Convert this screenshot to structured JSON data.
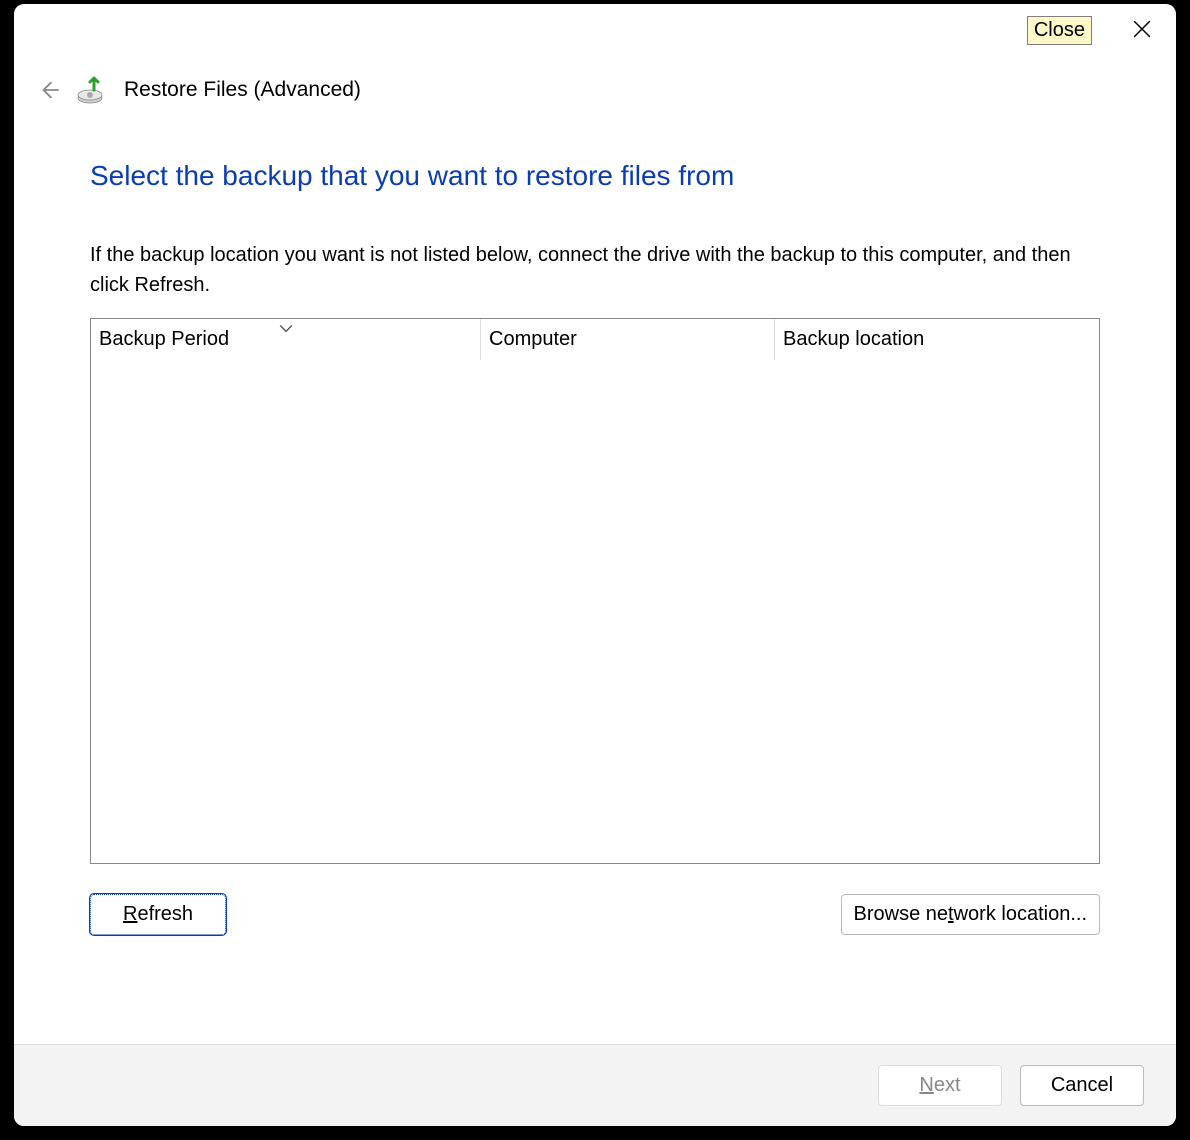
{
  "titlebar": {
    "close_tooltip": "Close"
  },
  "header": {
    "title": "Restore Files (Advanced)"
  },
  "main": {
    "heading": "Select the backup that you want to restore files from",
    "description": "If the backup location you want is not listed below, connect the drive with the backup to this computer, and then click Refresh.",
    "columns": {
      "col1": "Backup Period",
      "col2": "Computer",
      "col3": "Backup location"
    },
    "rows": []
  },
  "buttons": {
    "refresh_pre": "",
    "refresh_u": "R",
    "refresh_post": "efresh",
    "browse_pre": "Browse ne",
    "browse_u": "t",
    "browse_post": "work location..."
  },
  "footer": {
    "next_pre": "",
    "next_u": "N",
    "next_post": "ext",
    "cancel": "Cancel"
  }
}
